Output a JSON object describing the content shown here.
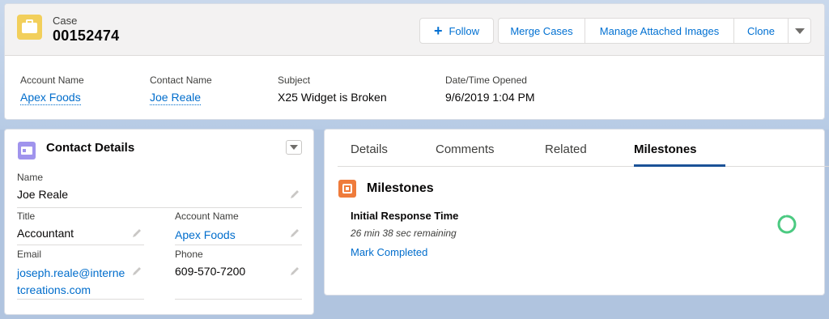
{
  "record": {
    "object_label": "Case",
    "number": "00152474"
  },
  "actions": {
    "follow": "Follow",
    "merge_cases": "Merge Cases",
    "manage_images": "Manage Attached Images",
    "clone": "Clone"
  },
  "highlights": {
    "account_name_label": "Account Name",
    "account_name_value": "Apex Foods",
    "contact_name_label": "Contact Name",
    "contact_name_value": "Joe Reale",
    "subject_label": "Subject",
    "subject_value": "X25 Widget is Broken",
    "opened_label": "Date/Time Opened",
    "opened_value": "9/6/2019 1:04 PM"
  },
  "contact": {
    "title": "Contact Details",
    "name_label": "Name",
    "name_value": "Joe Reale",
    "title_label": "Title",
    "title_value": "Accountant",
    "account_label": "Account Name",
    "account_value": "Apex Foods",
    "email_label": "Email",
    "email_line1": "joseph.reale@interne",
    "email_line2": "tcreations.com",
    "phone_label": "Phone",
    "phone_value": "609-570-7200"
  },
  "tabs": [
    "Details",
    "Comments",
    "Related",
    "Milestones"
  ],
  "active_tab": "Milestones",
  "milestones": {
    "title": "Milestones",
    "item_name": "Initial Response Time",
    "remaining": "26 min 38 sec remaining",
    "action": "Mark Completed",
    "progress_fraction": 0.95
  },
  "colors": {
    "link": "#006dcc",
    "case_icon": "#f2cf5b",
    "contact_icon": "#a094ed",
    "milestone_icon": "#ef7b3b",
    "active_tab_underline": "#1b5297",
    "progress_ring": "#4bca81"
  },
  "icons": {
    "case": "briefcase-icon",
    "follow": "plus-icon",
    "more": "chevron-down-icon",
    "contact": "contact-card-icon",
    "edit": "pencil-icon",
    "milestone": "milestone-icon"
  }
}
